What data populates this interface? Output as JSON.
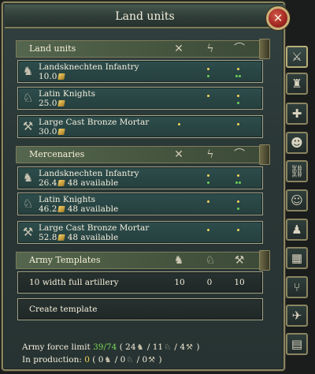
{
  "window": {
    "title": "Land units",
    "close_icon": "close-icon"
  },
  "sections": {
    "land_units": {
      "title": "Land units",
      "header_icons": [
        "crossed-swords-icon",
        "lightning-icon",
        "horn-icon"
      ],
      "rows": [
        {
          "name": "Landsknechten Infantry",
          "cost": "10.0",
          "icon": "infantry-icon"
        },
        {
          "name": "Latin Knights",
          "cost": "25.0",
          "icon": "cavalry-icon"
        },
        {
          "name": "Large Cast Bronze Mortar",
          "cost": "30.0",
          "icon": "cannon-icon"
        }
      ]
    },
    "mercenaries": {
      "title": "Mercenaries",
      "rows": [
        {
          "name": "Landsknechten Infantry",
          "cost": "26.4",
          "available": "48 available",
          "icon": "infantry-icon"
        },
        {
          "name": "Latin Knights",
          "cost": "46.2",
          "available": "48 available",
          "icon": "cavalry-icon"
        },
        {
          "name": "Large Cast Bronze Mortar",
          "cost": "52.8",
          "available": "48 available",
          "icon": "cannon-icon"
        }
      ]
    },
    "army_templates": {
      "title": "Army Templates",
      "header_icons": [
        "infantry-icon",
        "cavalry-icon",
        "cannon-icon"
      ],
      "templates": [
        {
          "name": "10 width full artillery",
          "infantry": "10",
          "cavalry": "0",
          "artillery": "10"
        }
      ],
      "create_label": "Create template"
    }
  },
  "footer": {
    "force_limit_label": "Army force limit",
    "force_limit_value": "39/74",
    "force_limit_open": "(",
    "infantry_count": "24",
    "sep1": "/",
    "cavalry_count": "11",
    "sep2": "/",
    "artillery_count": "4",
    "force_limit_close": ")",
    "production_label": "In production:",
    "production_value": "0",
    "prod_open": "(",
    "prod_infantry": "0",
    "prod_sep1": "/",
    "prod_cavalry": "0",
    "prod_sep2": "/",
    "prod_artillery": "0",
    "prod_close": ")"
  },
  "side_tabs": [
    "army-icon",
    "fortress-icon",
    "add-unit-icon",
    "leader-icon",
    "chain-icon",
    "theater-icon",
    "soldier-icon",
    "map-icon",
    "split-icon",
    "dove-icon",
    "territory-map-icon"
  ],
  "colors": {
    "green": "#79d657",
    "yellow": "#f1d55c",
    "frame": "#8a8460"
  }
}
